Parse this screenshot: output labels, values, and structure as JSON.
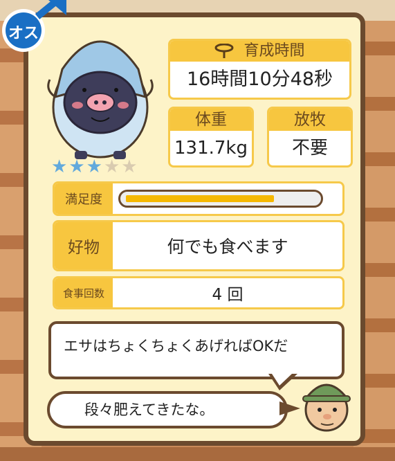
{
  "gender": {
    "label": "オス",
    "color": "#1a6fc4"
  },
  "pet": {
    "rarity_stars": 3,
    "rarity_max": 5
  },
  "growth_time": {
    "title": "育成時間",
    "value": "16時間10分48秒"
  },
  "weight": {
    "title": "体重",
    "value": "131.7kg"
  },
  "pasture": {
    "title": "放牧",
    "value": "不要"
  },
  "satisfaction": {
    "label": "満足度",
    "fraction": 0.78
  },
  "favorite_food": {
    "label": "好物",
    "value": "何でも食べます"
  },
  "meal_count": {
    "label": "食事回数",
    "value": "4 回"
  },
  "dialogue": {
    "line1": "エサはちょくちょくあげればOKだ",
    "line2": "段々肥えてきたな。"
  },
  "colors": {
    "panel_border": "#6b4a2e",
    "label_bg": "#f7c63f",
    "star_on": "#62a9dc",
    "bar_fill": "#f6b800"
  }
}
